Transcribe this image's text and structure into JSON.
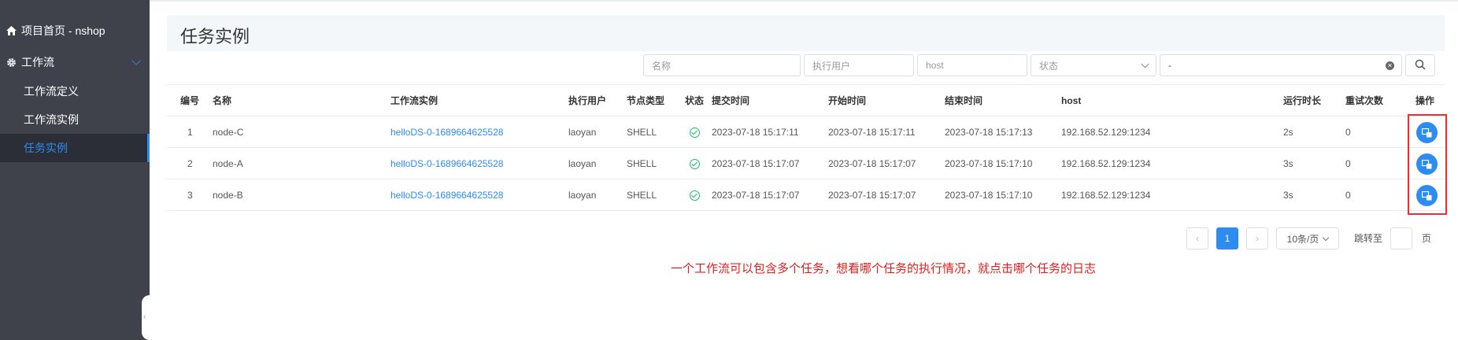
{
  "sidebar": {
    "project_home": "项目首页 - nshop",
    "workflow_group": "工作流",
    "items": [
      {
        "label": "工作流定义"
      },
      {
        "label": "工作流实例"
      },
      {
        "label": "任务实例"
      }
    ]
  },
  "header": {
    "title": "任务实例"
  },
  "filters": {
    "name_placeholder": "名称",
    "user_placeholder": "执行用户",
    "host_placeholder": "host",
    "state_placeholder": "状态",
    "date_range_value": "-"
  },
  "table": {
    "columns": [
      "编号",
      "名称",
      "工作流实例",
      "执行用户",
      "节点类型",
      "状态",
      "提交时间",
      "开始时间",
      "结束时间",
      "host",
      "运行时长",
      "重试次数",
      "操作"
    ],
    "rows": [
      {
        "id": "1",
        "name": "node-C",
        "instance": "helloDS-0-1689664625528",
        "user": "laoyan",
        "type": "SHELL",
        "submit": "2023-07-18 15:17:11",
        "start": "2023-07-18 15:17:11",
        "end": "2023-07-18 15:17:13",
        "host": "192.168.52.129:1234",
        "duration": "2s",
        "retry": "0"
      },
      {
        "id": "2",
        "name": "node-A",
        "instance": "helloDS-0-1689664625528",
        "user": "laoyan",
        "type": "SHELL",
        "submit": "2023-07-18 15:17:07",
        "start": "2023-07-18 15:17:07",
        "end": "2023-07-18 15:17:10",
        "host": "192.168.52.129:1234",
        "duration": "3s",
        "retry": "0"
      },
      {
        "id": "3",
        "name": "node-B",
        "instance": "helloDS-0-1689664625528",
        "user": "laoyan",
        "type": "SHELL",
        "submit": "2023-07-18 15:17:07",
        "start": "2023-07-18 15:17:07",
        "end": "2023-07-18 15:17:10",
        "host": "192.168.52.129:1234",
        "duration": "3s",
        "retry": "0"
      }
    ]
  },
  "pagination": {
    "current_page": "1",
    "page_size": "10条/页",
    "jump_label": "跳转至",
    "page_unit": "页"
  },
  "annotation": "一个工作流可以包含多个任务，想看哪个任务的执行情况，就点击哪个任务的日志",
  "colors": {
    "accent": "#2d8cf0",
    "sidebar_bg": "#3f424b",
    "success": "#19be6b",
    "annotation": "#e02020"
  }
}
